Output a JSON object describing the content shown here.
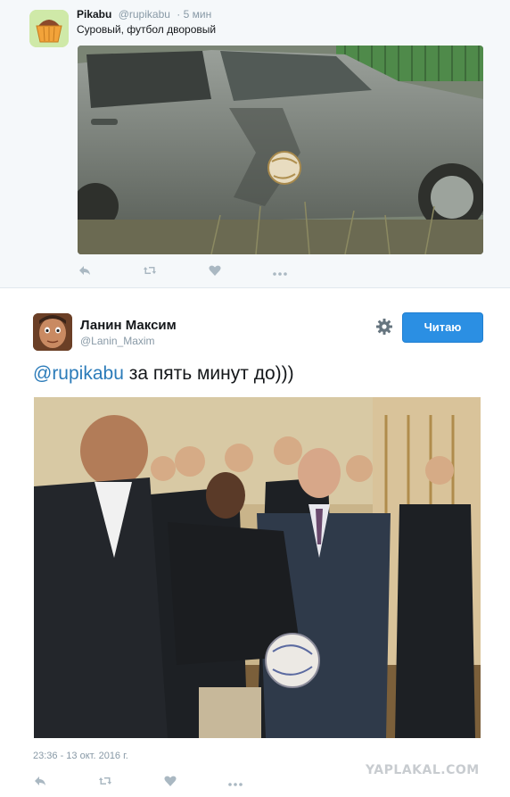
{
  "tweet1": {
    "author_name": "Pikabu",
    "author_handle": "@rupikabu",
    "time": "5 мин",
    "text": "Суровый, футбол дворовый",
    "avatar_icon": "pikabu-cupcake-icon",
    "media": "photo-crashed-car-with-ball"
  },
  "tweet2": {
    "author_name": "Ланин Максим",
    "author_handle": "@Lanin_Maxim",
    "follow_label": "Читаю",
    "mention": "@rupikabu",
    "text": " за пять минут до)))",
    "date": "23:36 - 13 окт. 2016 г.",
    "media": "photo-people-holding-ball"
  },
  "actions": [
    "reply-icon",
    "retweet-icon",
    "like-icon",
    "more-icon"
  ],
  "watermark": "YAPLAKAL.COM",
  "colors": {
    "accent": "#2b8fe3",
    "mention": "#2b7bb9",
    "muted": "#8899a6",
    "icon": "#aab8c2"
  }
}
